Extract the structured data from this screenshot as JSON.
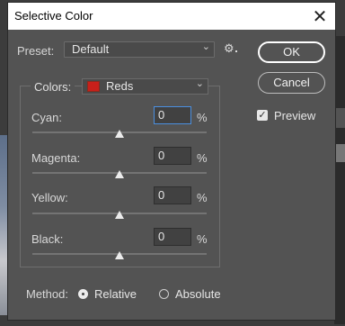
{
  "dialog": {
    "title": "Selective Color",
    "close_glyph": "✕"
  },
  "preset": {
    "label": "Preset:",
    "value": "Default"
  },
  "buttons": {
    "ok": "OK",
    "cancel": "Cancel"
  },
  "preview": {
    "label": "Preview",
    "checked": true
  },
  "colors": {
    "label": "Colors:",
    "value": "Reds",
    "swatch_color": "#c8201a"
  },
  "sliders": [
    {
      "label": "Cyan:",
      "value": "0",
      "unit": "%",
      "level_percent": 0
    },
    {
      "label": "Magenta:",
      "value": "0",
      "unit": "%",
      "level_percent": 0
    },
    {
      "label": "Yellow:",
      "value": "0",
      "unit": "%",
      "level_percent": 0
    },
    {
      "label": "Black:",
      "value": "0",
      "unit": "%",
      "level_percent": 0
    }
  ],
  "method": {
    "label": "Method:",
    "options": [
      "Relative",
      "Absolute"
    ],
    "selected": "Relative"
  },
  "icons": {
    "gear": "gear-icon",
    "chevron": "chevron-down-icon",
    "close": "close-icon",
    "check": "checkmark-icon"
  }
}
